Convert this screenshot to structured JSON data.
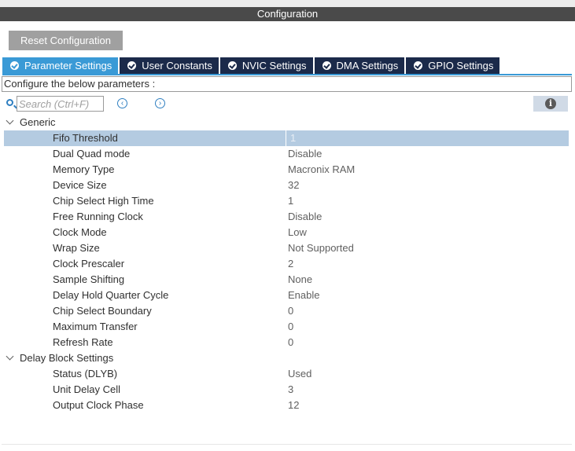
{
  "window": {
    "title": "Configuration"
  },
  "toolbar": {
    "reset_label": "Reset Configuration"
  },
  "tabs": [
    {
      "label": "Parameter Settings",
      "active": true
    },
    {
      "label": "User Constants",
      "active": false
    },
    {
      "label": "NVIC Settings",
      "active": false
    },
    {
      "label": "DMA Settings",
      "active": false
    },
    {
      "label": "GPIO Settings",
      "active": false
    }
  ],
  "configure_text": "Configure the below parameters :",
  "search": {
    "placeholder": "Search (Ctrl+F)",
    "value": ""
  },
  "icons": {
    "prev": "chevron-left-circle-icon",
    "next": "chevron-right-circle-icon",
    "info": "info-icon",
    "search": "search-icon"
  },
  "colors": {
    "active_tab": "#3a9ad6",
    "tab": "#1b2a4a",
    "selected_row": "#b4cbe1",
    "title_bar": "#4a4a4a"
  },
  "groups": [
    {
      "label": "Generic",
      "params": [
        {
          "name": "Fifo Threshold",
          "value": "1",
          "selected": true
        },
        {
          "name": "Dual Quad mode",
          "value": "Disable"
        },
        {
          "name": "Memory Type",
          "value": "Macronix RAM"
        },
        {
          "name": "Device Size",
          "value": "32"
        },
        {
          "name": "Chip Select High Time",
          "value": "1"
        },
        {
          "name": "Free Running Clock",
          "value": "Disable"
        },
        {
          "name": "Clock Mode",
          "value": "Low"
        },
        {
          "name": "Wrap Size",
          "value": "Not Supported"
        },
        {
          "name": "Clock Prescaler",
          "value": "2"
        },
        {
          "name": "Sample Shifting",
          "value": "None"
        },
        {
          "name": "Delay Hold Quarter Cycle",
          "value": "Enable"
        },
        {
          "name": "Chip Select Boundary",
          "value": "0"
        },
        {
          "name": "Maximum Transfer",
          "value": "0"
        },
        {
          "name": "Refresh Rate",
          "value": "0"
        }
      ]
    },
    {
      "label": "Delay Block Settings",
      "params": [
        {
          "name": "Status (DLYB)",
          "value": "Used"
        },
        {
          "name": "Unit Delay Cell",
          "value": "3"
        },
        {
          "name": "Output Clock Phase",
          "value": "12"
        }
      ]
    }
  ]
}
